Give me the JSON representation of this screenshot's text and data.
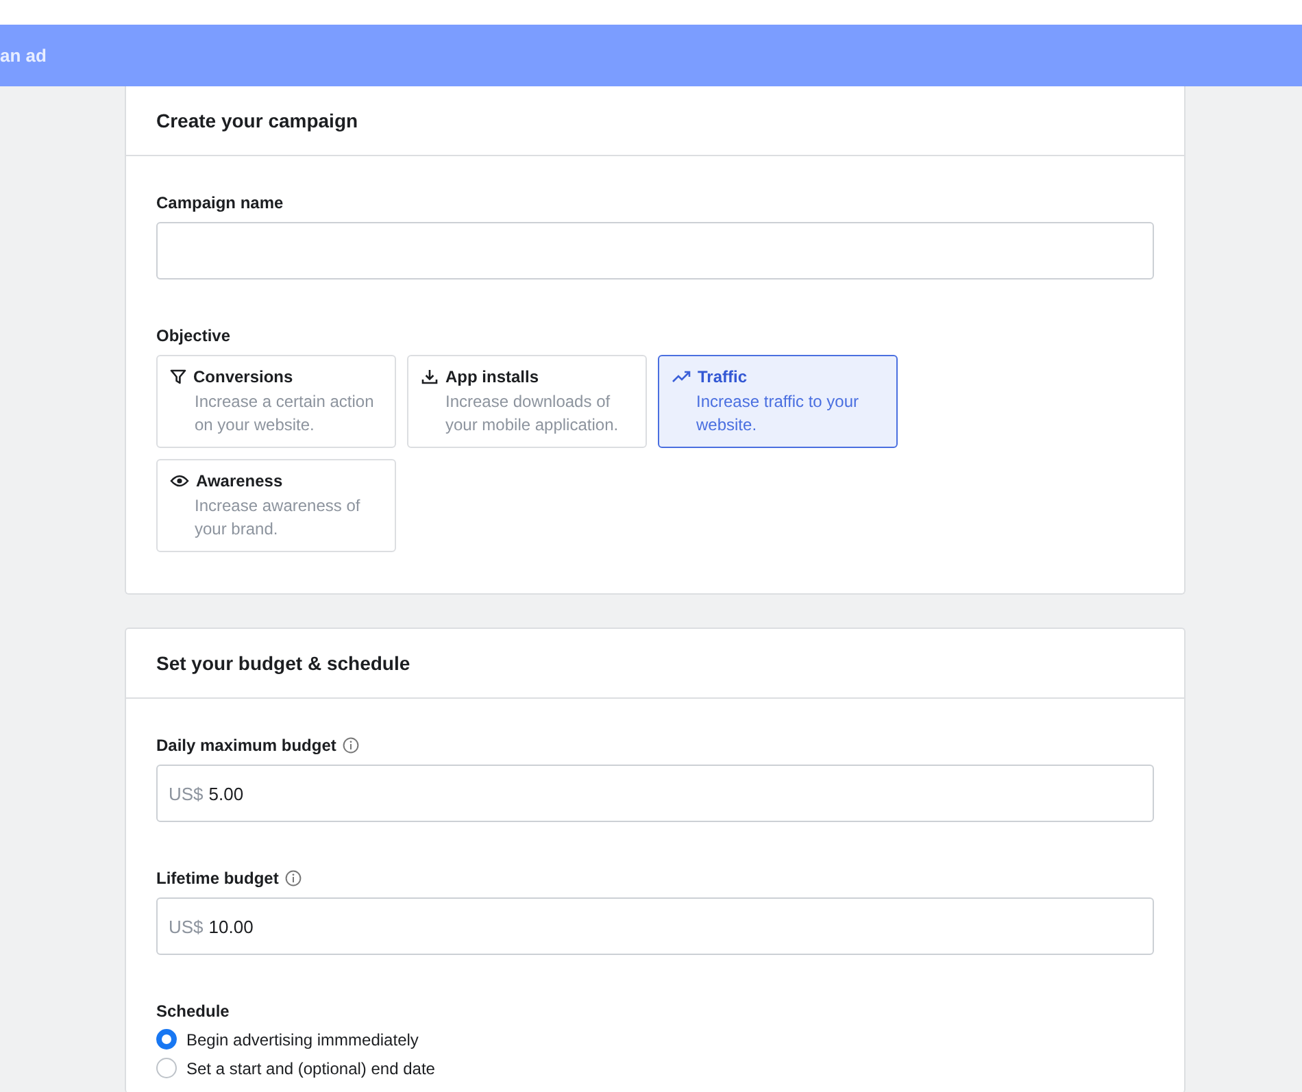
{
  "banner": {
    "title": "an ad"
  },
  "campaign_card": {
    "title": "Create your campaign",
    "name_field": {
      "label": "Campaign name"
    },
    "objective_label": "Objective",
    "objectives": [
      {
        "kind": "filter",
        "title": "Conversions",
        "description": "Increase a certain action on your website.",
        "selected": false
      },
      {
        "kind": "download",
        "title": "App installs",
        "description": "Increase downloads of your mobile application.",
        "selected": false
      },
      {
        "kind": "trend",
        "title": "Traffic",
        "description": "Increase traffic to your website.",
        "selected": true
      },
      {
        "kind": "eye",
        "title": "Awareness",
        "description": "Increase awareness of your brand.",
        "selected": false
      }
    ]
  },
  "budget_card": {
    "title": "Set your budget & schedule",
    "fields": [
      {
        "label": "Daily maximum budget",
        "prefix": "US$",
        "value": "5.00"
      },
      {
        "label": "Lifetime budget",
        "prefix": "US$",
        "value": "10.00"
      }
    ],
    "schedule_label": "Schedule",
    "schedule_options": [
      {
        "label": "Begin advertising immmediately",
        "selected": true
      },
      {
        "label": "Set a start and (optional) end date",
        "selected": false
      }
    ]
  }
}
